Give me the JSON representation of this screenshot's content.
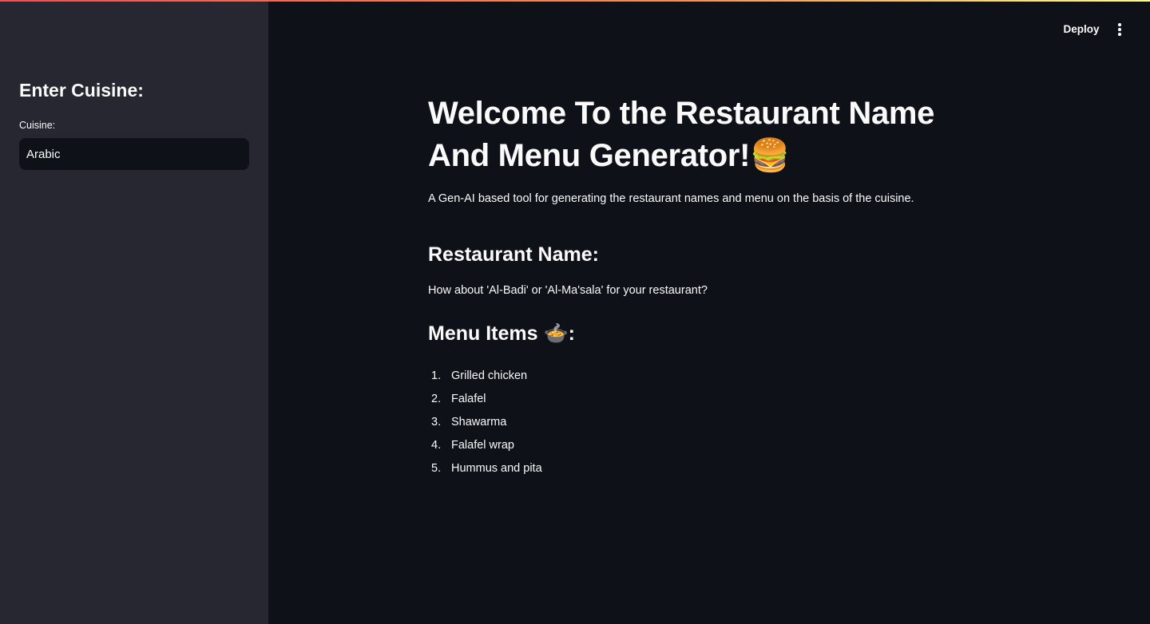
{
  "header": {
    "deploy_label": "Deploy",
    "menu_icon": "kebab-menu-icon"
  },
  "sidebar": {
    "heading": "Enter Cuisine:",
    "input_label": "Cuisine:",
    "input_value": "Arabic"
  },
  "main": {
    "title_line1": "Welcome To the Restaurant Name",
    "title_line2": "And Menu Generator!",
    "title_emoji": "🍔",
    "subtitle": "A Gen-AI based tool for generating the restaurant names and menu on the basis of the cuisine.",
    "restaurant_heading": "Restaurant Name:",
    "restaurant_text": "How about 'Al-Badi' or 'Al-Ma'sala' for your restaurant?",
    "menu_heading_prefix": "Menu Items ",
    "menu_heading_emoji": "🍲",
    "menu_heading_suffix": ":",
    "menu_items": [
      {
        "num": "1.",
        "text": "Grilled chicken"
      },
      {
        "num": "2.",
        "text": "Falafel"
      },
      {
        "num": "3.",
        "text": "Shawarma"
      },
      {
        "num": "4.",
        "text": "Falafel wrap"
      },
      {
        "num": "5.",
        "text": "Hummus and pita"
      }
    ]
  },
  "colors": {
    "background": "#0e1117",
    "sidebar": "#262730",
    "text": "#fafafa",
    "accent": "#ff4b4b"
  }
}
